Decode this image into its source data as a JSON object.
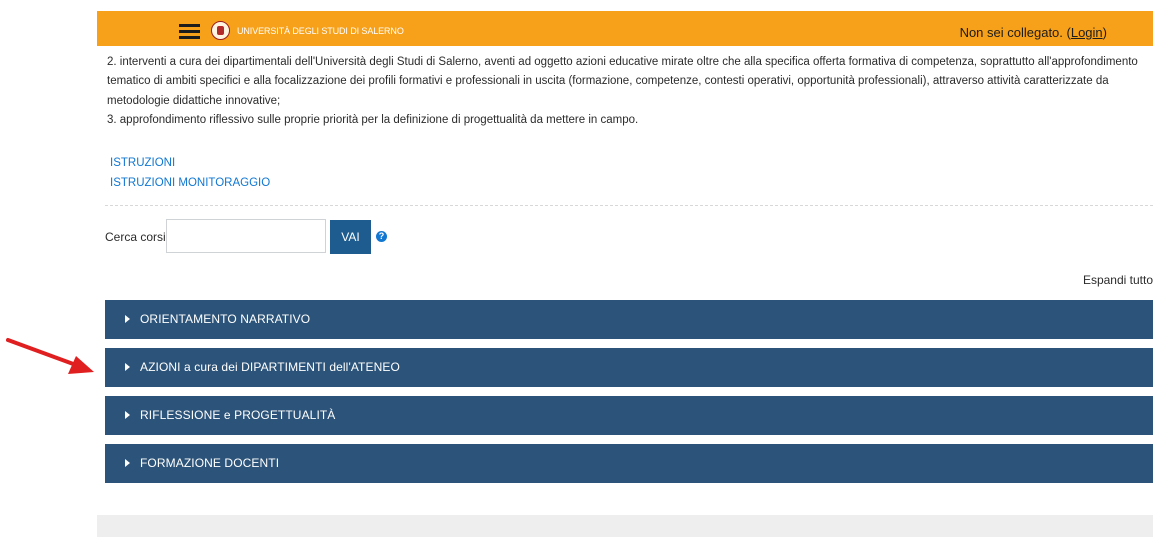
{
  "header": {
    "site_name": "UNIVERSITÀ DEGLI STUDI DI SALERNO",
    "login_prefix": "Non sei collegato. (",
    "login_link": "Login",
    "login_suffix": ")"
  },
  "summary": {
    "paragraph_2": "2. interventi a cura dei dipartimentali dell'Università degli Studi di Salerno, aventi ad oggetto azioni educative mirate oltre che alla specifica offerta formativa di competenza, soprattutto all'approfondimento tematico di ambiti specifici e alla focalizzazione dei profili formativi e professionali in uscita (formazione, competenze, contesti operativi, opportunità professionali), attraverso attività caratterizzate da metodologie didattiche innovative;",
    "paragraph_3": "3. approfondimento riflessivo sulle proprie priorità per la definizione di progettualità da mettere in campo.",
    "links": [
      "ISTRUZIONI",
      "ISTRUZIONI MONITORAGGIO"
    ]
  },
  "search": {
    "label": "Cerca corsi",
    "value": "",
    "button": "VAI",
    "help": "?"
  },
  "expand_all": "Espandi tutto",
  "categories": [
    {
      "label": "ORIENTAMENTO NARRATIVO"
    },
    {
      "label": "AZIONI a cura dei DIPARTIMENTI dell'ATENEO"
    },
    {
      "label": "RIFLESSIONE e PROGETTUALITÀ"
    },
    {
      "label": "FORMAZIONE DOCENTI"
    }
  ],
  "colors": {
    "header_bg": "#f7a01a",
    "category_bg": "#2c547a",
    "link": "#1177d1",
    "annotation_arrow": "#e02020"
  }
}
